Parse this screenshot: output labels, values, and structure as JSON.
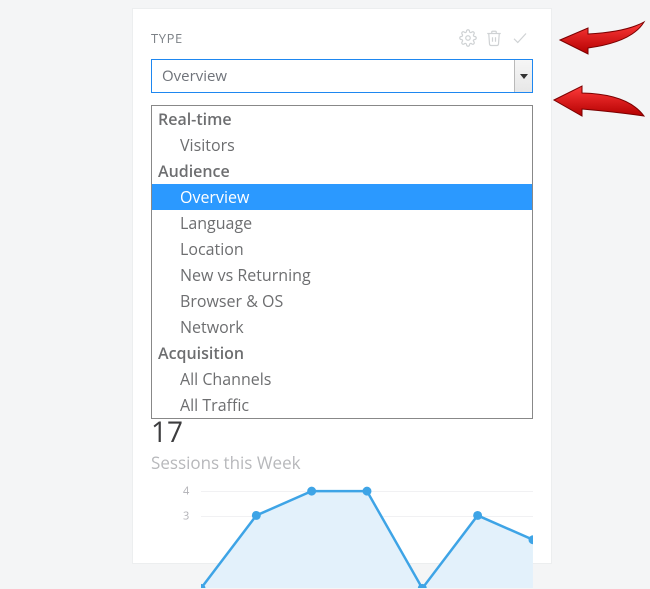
{
  "header": {
    "type_label": "TYPE",
    "icons": {
      "settings": "gear-icon",
      "delete": "trash-icon",
      "confirm": "check-icon"
    }
  },
  "select": {
    "selected": "Overview"
  },
  "dropdown": [
    {
      "kind": "group",
      "label": "Real-time"
    },
    {
      "kind": "item",
      "label": "Visitors"
    },
    {
      "kind": "group",
      "label": "Audience"
    },
    {
      "kind": "item",
      "label": "Overview",
      "selected": true
    },
    {
      "kind": "item",
      "label": "Language"
    },
    {
      "kind": "item",
      "label": "Location"
    },
    {
      "kind": "item",
      "label": "New vs Returning"
    },
    {
      "kind": "item",
      "label": "Browser & OS"
    },
    {
      "kind": "item",
      "label": "Network"
    },
    {
      "kind": "group",
      "label": "Acquisition"
    },
    {
      "kind": "item",
      "label": "All Channels"
    },
    {
      "kind": "item",
      "label": "All Traffic"
    }
  ],
  "stats": {
    "value": "17",
    "label": "Sessions this Week"
  },
  "chart_data": {
    "type": "line",
    "x": [
      0,
      1,
      2,
      3,
      4,
      5,
      6
    ],
    "values": [
      0,
      3,
      4,
      4,
      0,
      3,
      2
    ],
    "yticks": [
      3,
      4
    ],
    "ylim": [
      0,
      4.5
    ],
    "color": "#3ea4e6",
    "fill": "#e3f1fb",
    "title": "",
    "xlabel": "",
    "ylabel": ""
  }
}
